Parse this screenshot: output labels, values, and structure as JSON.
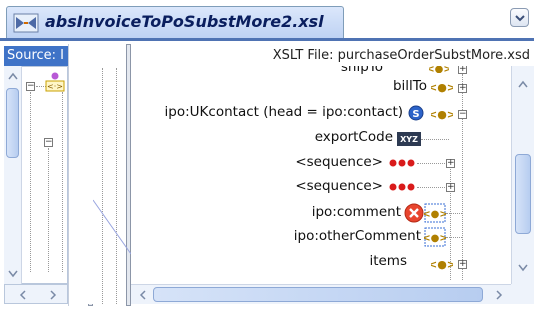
{
  "tab": {
    "title": "absInvoiceToPoSubstMore2.xsl",
    "icon": "xslt-map-icon"
  },
  "source_panel": {
    "header": "Source: I"
  },
  "target_panel": {
    "header": "XSLT File: purchaseOrderSubstMore.xsd",
    "nodes": [
      {
        "label": "shipTo",
        "icon": "element-icon",
        "partial": true
      },
      {
        "label": "billTo",
        "icon": "element-icon",
        "expander": "+"
      },
      {
        "label": "ipo:UKcontact (head = ipo:contact)",
        "icon": "element-icon",
        "badge": "S",
        "expander": "-"
      },
      {
        "label": "exportCode",
        "icon": "xyz-icon",
        "badge_text": "XYZ"
      },
      {
        "label": "<sequence>",
        "icon": "sequence-icon",
        "expander": "+"
      },
      {
        "label": "<sequence>",
        "icon": "sequence-icon",
        "expander": "+"
      },
      {
        "label": "ipo:comment",
        "icon": "error-icon"
      },
      {
        "label": "ipo:otherComment",
        "icon": "element-icon"
      },
      {
        "label": "items",
        "icon": "element-icon",
        "expander": "+",
        "partial": true
      }
    ]
  },
  "colors": {
    "tab_bg": "#c9dbf6",
    "source_header_bg": "#3f73c7",
    "tab_underline": "#4f73b3",
    "error_red": "#e8452e",
    "badge_blue": "#2c63c9",
    "link_line": "#9aa6e0"
  }
}
